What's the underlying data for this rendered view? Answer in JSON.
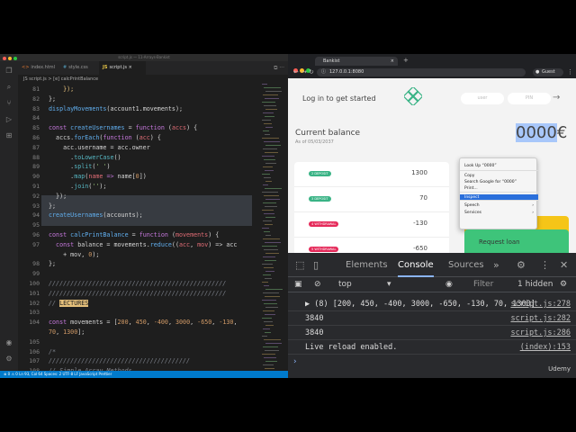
{
  "vscode": {
    "title": "script.js — 11-Arrays-Bankist",
    "tabs": [
      "index.html",
      "style.css",
      "script.js"
    ],
    "tab_ext": {
      "html": "<>",
      "css": "#",
      "js": "JS"
    },
    "breadcrumb": "JS script.js > [e] calcPrintBalance",
    "status": "⊗ 0 ⚠ 0   Ln 93, Col 64   Spaces: 2   UTF-8   LF   JavaScript   Prettier",
    "lines": [
      {
        "n": "81",
        "t": [
          [
            "p",
            "    });"
          ]
        ]
      },
      {
        "n": "82",
        "t": [
          [
            "",
            "};"
          ]
        ]
      },
      {
        "n": "83",
        "t": [
          [
            "f",
            "displayMovements"
          ],
          [
            "",
            "("
          ],
          [
            "",
            "account1.movements"
          ],
          [
            "",
            ");"
          ]
        ]
      },
      {
        "n": "84",
        "t": []
      },
      {
        "n": "85",
        "t": [
          [
            "k",
            "const "
          ],
          [
            "f",
            "createUsernames"
          ],
          [
            "",
            " = "
          ],
          [
            "k",
            "function "
          ],
          [
            "",
            "("
          ],
          [
            "v",
            "accs"
          ],
          [
            "",
            ") {"
          ]
        ]
      },
      {
        "n": "86",
        "t": [
          [
            "",
            "  accs."
          ],
          [
            "f",
            "forEach"
          ],
          [
            "",
            "("
          ],
          [
            "k",
            "function "
          ],
          [
            "",
            "("
          ],
          [
            "v",
            "acc"
          ],
          [
            "",
            ") {"
          ]
        ]
      },
      {
        "n": "87",
        "t": [
          [
            "",
            "    acc.username = acc.owner"
          ]
        ]
      },
      {
        "n": "88",
        "t": [
          [
            "",
            "      ."
          ],
          [
            "t",
            "toLowerCase"
          ],
          [
            "",
            "()"
          ]
        ]
      },
      {
        "n": "89",
        "t": [
          [
            "",
            "      ."
          ],
          [
            "t",
            "split"
          ],
          [
            "",
            "("
          ],
          [
            "s",
            "' '"
          ],
          [
            "",
            ")"
          ]
        ]
      },
      {
        "n": "90",
        "t": [
          [
            "",
            "      ."
          ],
          [
            "t",
            "map"
          ],
          [
            "",
            "("
          ],
          [
            "v",
            "name"
          ],
          [
            "k",
            " => "
          ],
          [
            "",
            "name["
          ],
          [
            "n",
            "0"
          ],
          [
            "",
            "])"
          ]
        ]
      },
      {
        "n": "91",
        "t": [
          [
            "",
            "      ."
          ],
          [
            "t",
            "join"
          ],
          [
            "",
            "("
          ],
          [
            "s",
            "''"
          ],
          [
            "",
            ");"
          ]
        ]
      },
      {
        "n": "92",
        "t": [
          [
            "",
            "  });"
          ]
        ]
      },
      {
        "n": "93",
        "t": [
          [
            "",
            "};"
          ]
        ]
      },
      {
        "n": "94",
        "t": [
          [
            "f",
            "createUsernames"
          ],
          [
            "",
            "(accounts);"
          ]
        ]
      },
      {
        "n": "95",
        "t": []
      },
      {
        "n": "96",
        "t": [
          [
            "k",
            "const "
          ],
          [
            "f",
            "calcPrintBalance"
          ],
          [
            "",
            " = "
          ],
          [
            "k",
            "function "
          ],
          [
            "",
            "("
          ],
          [
            "v",
            "movements"
          ],
          [
            "",
            ") {"
          ]
        ]
      },
      {
        "n": "97",
        "t": [
          [
            "k",
            "  const "
          ],
          [
            "",
            "balance = movements."
          ],
          [
            "f",
            "reduce"
          ],
          [
            "",
            "(("
          ],
          [
            "v",
            "acc"
          ],
          [
            "",
            ", "
          ],
          [
            "v",
            "mov"
          ],
          [
            "",
            ") => acc"
          ]
        ]
      },
      {
        "n": "",
        "t": [
          [
            "",
            "    + mov, "
          ],
          [
            "n",
            "0"
          ],
          [
            "",
            ");"
          ]
        ]
      },
      {
        "n": "98",
        "t": [
          [
            "",
            "};"
          ]
        ]
      },
      {
        "n": "99",
        "t": []
      },
      {
        "n": "100",
        "t": [
          [
            "c",
            "/////////////////////////////////////////////////"
          ]
        ]
      },
      {
        "n": "101",
        "t": [
          [
            "c",
            "/////////////////////////////////////////////////"
          ]
        ]
      },
      {
        "n": "102",
        "t": [
          [
            "c",
            "// "
          ],
          [
            "hl",
            "LECTURES"
          ]
        ]
      },
      {
        "n": "103",
        "t": []
      },
      {
        "n": "104",
        "t": [
          [
            "k",
            "const "
          ],
          [
            "",
            "movements = ["
          ],
          [
            "n",
            "200"
          ],
          [
            "",
            ", "
          ],
          [
            "n",
            "450"
          ],
          [
            "",
            ", "
          ],
          [
            "n",
            "-400"
          ],
          [
            "",
            ", "
          ],
          [
            "n",
            "3000"
          ],
          [
            "",
            ", "
          ],
          [
            "n",
            "-650"
          ],
          [
            "",
            ", "
          ],
          [
            "n",
            "-130"
          ],
          [
            "",
            ","
          ]
        ]
      },
      {
        "n": "",
        "t": [
          [
            "n",
            "70"
          ],
          [
            "",
            ", "
          ],
          [
            "n",
            "1300"
          ],
          [
            "",
            "];"
          ]
        ]
      },
      {
        "n": "105",
        "t": []
      },
      {
        "n": "106",
        "t": [
          [
            "c",
            "/*"
          ]
        ]
      },
      {
        "n": "107",
        "t": [
          [
            "c",
            "///////////////////////////////////////"
          ]
        ]
      },
      {
        "n": "108",
        "t": [
          [
            "c",
            "// Simple Array Methods"
          ]
        ]
      }
    ]
  },
  "browser": {
    "tab_title": "Bankist",
    "url": "127.0.0.1:8080",
    "profile": "Guest",
    "login_text": "Log in to get started",
    "user_placeholder": "user",
    "pin_placeholder": "PIN",
    "balance_label": "Current balance",
    "as_of": "As of 05/03/2037",
    "balance_value_selected": "0000",
    "balance_value_rest": "€",
    "movements": [
      {
        "type": "2 DEPOSIT",
        "value": "1300",
        "color": "#39b385"
      },
      {
        "type": "3 DEPOSIT",
        "value": "70",
        "color": "#39b385"
      },
      {
        "type": "4 WITHDRAWAL",
        "value": "-130",
        "color": "#e52a5a"
      },
      {
        "type": "5 WITHDRAWAL",
        "value": "-650",
        "color": "#e52a5a"
      }
    ],
    "request_loan": "Request loan",
    "context_menu": [
      "Look Up “0000”",
      "Copy",
      "Search Google for “0000”",
      "Print...",
      "Inspect",
      "Speech",
      "Services"
    ]
  },
  "devtools": {
    "tabs": [
      "Elements",
      "Console",
      "Sources"
    ],
    "filter_context": "top",
    "filter_placeholder": "Filter",
    "hidden": "1 hidden",
    "rows": [
      {
        "text": "▶ (8) [200, 450, -400, 3000, -650, -130, 70, 1300]",
        "source": "script.js:278"
      },
      {
        "text": "3840",
        "source": "script.js:282"
      },
      {
        "text": "3840",
        "source": "script.js:286"
      },
      {
        "text": "Live reload enabled.",
        "source": "(index):153"
      }
    ],
    "watermark": "Udemy"
  }
}
